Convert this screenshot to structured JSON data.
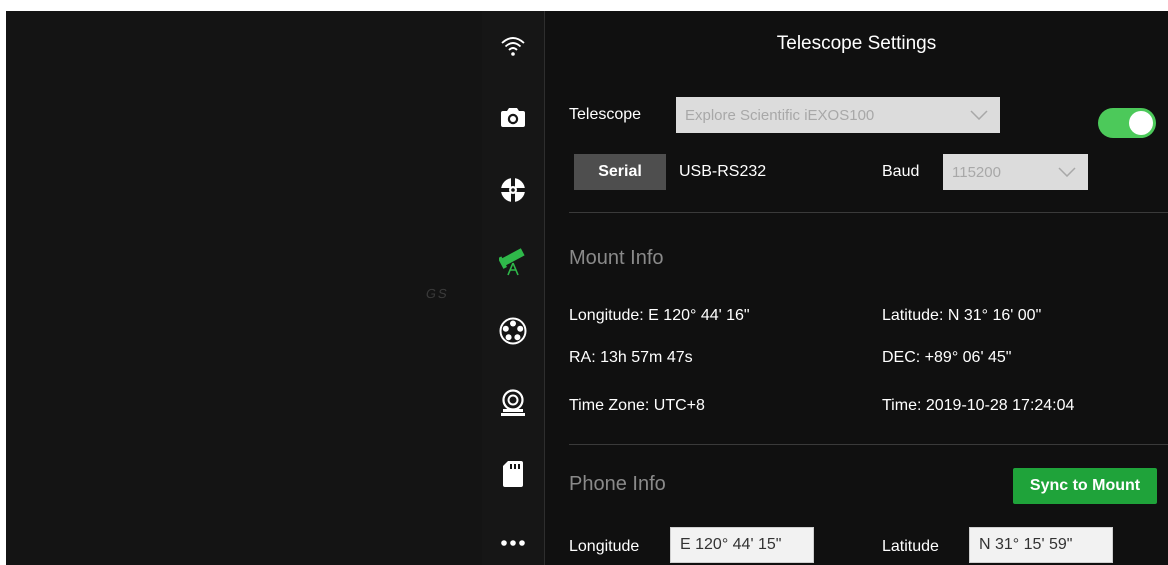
{
  "background_overlay": {
    "faint_text": "GS"
  },
  "sidebar": {
    "items": [
      {
        "icon": "wifi-icon",
        "active": false
      },
      {
        "icon": "camera-icon",
        "active": false
      },
      {
        "icon": "focuser-icon",
        "active": false
      },
      {
        "icon": "telescope-icon",
        "active": true
      },
      {
        "icon": "filter-wheel-icon",
        "active": false
      },
      {
        "icon": "guider-icon",
        "active": false
      },
      {
        "icon": "sd-card-icon",
        "active": false
      },
      {
        "icon": "more-icon",
        "active": false
      }
    ],
    "active_color": "#2fb84a"
  },
  "panel": {
    "title": "Telescope Settings",
    "telescope": {
      "label": "Telescope",
      "selected": "Explore Scientific iEXOS100",
      "enabled": true
    },
    "connection": {
      "mode_button": "Serial",
      "port": "USB-RS232",
      "baud_label": "Baud",
      "baud_value": "115200"
    },
    "mount_info": {
      "heading": "Mount Info",
      "longitude": "Longitude: E 120° 44' 16\"",
      "latitude": "Latitude: N 31° 16' 00\"",
      "ra": "RA: 13h 57m 47s",
      "dec": "DEC: +89° 06' 45\"",
      "time_zone": "Time Zone: UTC+8",
      "time": "Time: 2019-10-28 17:24:04"
    },
    "phone_info": {
      "heading": "Phone Info",
      "sync_button": "Sync to Mount",
      "longitude_label": "Longitude",
      "longitude_value": "E 120° 44' 15\"",
      "latitude_label": "Latitude",
      "latitude_value": "N 31° 15' 59\""
    }
  },
  "colors": {
    "accent_green": "#1fa33a",
    "toggle_on": "#4cc95a",
    "panel_bg": "#101010"
  }
}
